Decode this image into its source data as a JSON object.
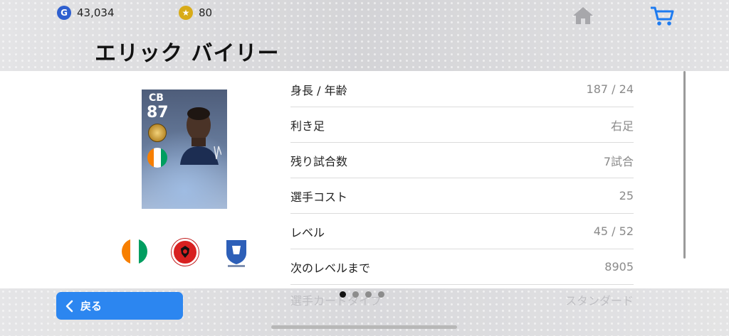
{
  "header": {
    "gp": {
      "icon": "gp-coin-icon",
      "label": "G",
      "amount": "43,034"
    },
    "coins": {
      "icon": "star-coin-icon",
      "label": "★",
      "amount": "80"
    },
    "home_icon": "home-icon",
    "cart_icon": "cart-icon",
    "player_name": "エリック バイリー"
  },
  "card": {
    "position": "CB",
    "rating": "87"
  },
  "stats": [
    {
      "label": "身長 / 年齢",
      "value": "187 / 24"
    },
    {
      "label": "利き足",
      "value": "右足"
    },
    {
      "label": "残り試合数",
      "value": "7試合"
    },
    {
      "label": "選手コスト",
      "value": "25"
    },
    {
      "label": "レベル",
      "value": "45 / 52"
    },
    {
      "label": "次のレベルまで",
      "value": "8905"
    }
  ],
  "faded_stat": {
    "label": "選手カードタイプ",
    "value": "スタンダード"
  },
  "pager": {
    "pages": 4,
    "active_index": 0
  },
  "footer": {
    "back_label": "戻る"
  },
  "colors": {
    "accent": "#2c86f0",
    "cart": "#1e7bf0"
  }
}
